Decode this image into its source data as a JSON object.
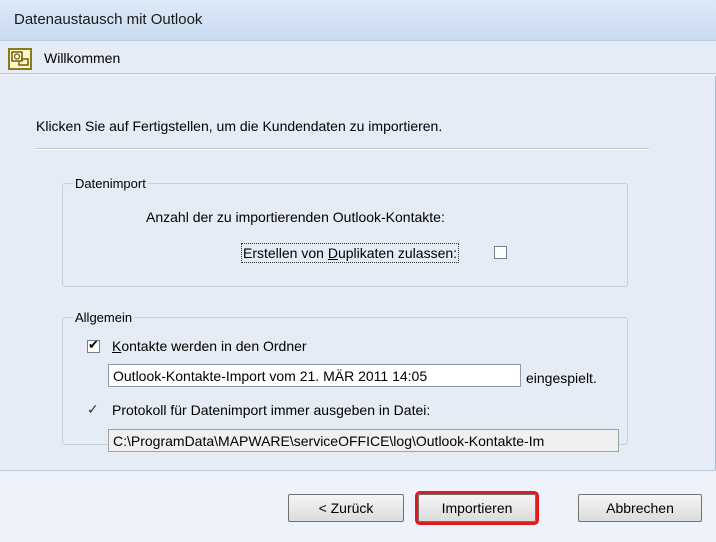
{
  "window": {
    "title": "Datenaustausch mit Outlook"
  },
  "header": {
    "title": "Willkommen",
    "icon": "outlook-import-icon"
  },
  "intro": "Klicken Sie auf Fertigstellen, um die Kundendaten zu importieren.",
  "datenimport": {
    "legend": "Datenimport",
    "count_label": "Anzahl der zu importierenden Outlook-Kontakte:",
    "duplicates": {
      "label_before": "Erstellen von ",
      "label_accel": "D",
      "label_after": "uplikaten zulassen:",
      "checked": false
    }
  },
  "allgemein": {
    "legend": "Allgemein",
    "contacts_checkbox": {
      "accel": "K",
      "label_rest": "ontakte werden in den Ordner",
      "checked": true
    },
    "folder_value": "Outlook-Kontakte-Import vom 21. MÄR 2011 14:05",
    "folder_suffix": "eingespielt.",
    "protocol_label": "Protokoll für Datenimport immer ausgeben in Datei:",
    "protocol_path": "C:\\ProgramData\\MAPWARE\\serviceOFFICE\\log\\Outlook-Kontakte-Im"
  },
  "buttons": {
    "back": "< Zurück",
    "import": "Importieren",
    "cancel": "Abbrechen"
  },
  "colors": {
    "highlight": "#e01b1b"
  }
}
